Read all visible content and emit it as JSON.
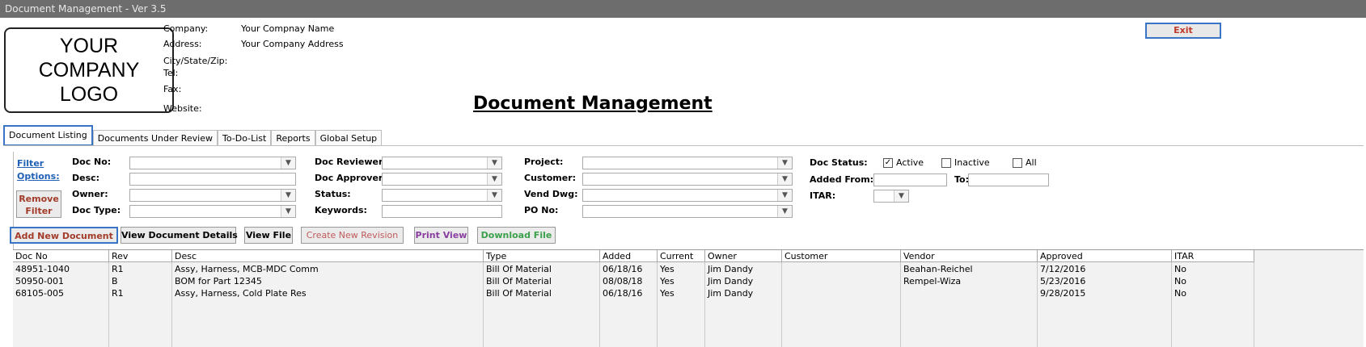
{
  "window": {
    "title": "Document Management - Ver 3.5"
  },
  "logo": {
    "line1": "YOUR",
    "line2": "COMPANY",
    "line3": "LOGO"
  },
  "company_info": {
    "company_label": "Company:",
    "company_value": "Your Compnay Name",
    "address_label": "Address:",
    "address_value": "Your Company Address",
    "city_label": "City/State/Zip:",
    "tel_label": "Tel:",
    "fax_label": "Fax:",
    "website_label": "Website:"
  },
  "exit_label": "Exit",
  "page_title": "Document Management",
  "tabs": [
    {
      "label": "Document Listing",
      "active": true
    },
    {
      "label": "Documents Under Review"
    },
    {
      "label": "To-Do-List"
    },
    {
      "label": "Reports"
    },
    {
      "label": "Global Setup"
    }
  ],
  "filters": {
    "link_line1": "Filter",
    "link_line2": "Options:",
    "remove_line1": "Remove",
    "remove_line2": "Filter",
    "doc_no": "Doc No:",
    "desc": "Desc:",
    "owner": "Owner:",
    "doc_type": "Doc Type:",
    "doc_reviewer": "Doc Reviewer:",
    "doc_approver": "Doc Approver:",
    "status": "Status:",
    "keywords": "Keywords:",
    "project": "Project:",
    "customer": "Customer:",
    "vend_dwg": "Vend Dwg:",
    "po_no": "PO No:",
    "doc_status": "Doc Status:",
    "added_from": "Added From:",
    "to": "To:",
    "itar": "ITAR:",
    "active": "Active",
    "inactive": "Inactive",
    "all": "All"
  },
  "actions": {
    "add_new": "Add New Document",
    "view_details": "View Document Details",
    "view_file": "View File",
    "create_revision": "Create New Revision",
    "print_view": "Print View",
    "download_file": "Download File"
  },
  "colors": {
    "add_new": "#a33b2a",
    "create_revision": "#c05a5a",
    "print_view": "#8a3fa0",
    "download_file": "#3aa04a",
    "focus_border": "#3a74c4"
  },
  "table": {
    "columns": [
      "Doc No",
      "Rev",
      "Desc",
      "Type",
      "Added",
      "Current",
      "Owner",
      "Customer",
      "Vendor",
      "Approved",
      "ITAR"
    ],
    "rows": [
      [
        "48951-1040",
        "R1",
        "Assy, Harness, MCB-MDC Comm",
        "Bill Of Material",
        "06/18/16",
        "Yes",
        "Jim Dandy",
        "",
        "Beahan-Reichel",
        "7/12/2016",
        "No"
      ],
      [
        "50950-001",
        "B",
        "BOM for Part 12345",
        "Bill Of Material",
        "08/08/18",
        "Yes",
        "Jim Dandy",
        "",
        "Rempel-Wiza",
        "5/23/2016",
        "No"
      ],
      [
        "68105-005",
        "R1",
        "Assy, Harness, Cold Plate Res",
        "Bill Of Material",
        "06/18/16",
        "Yes",
        "Jim Dandy",
        "",
        "",
        "9/28/2015",
        "No"
      ]
    ]
  }
}
